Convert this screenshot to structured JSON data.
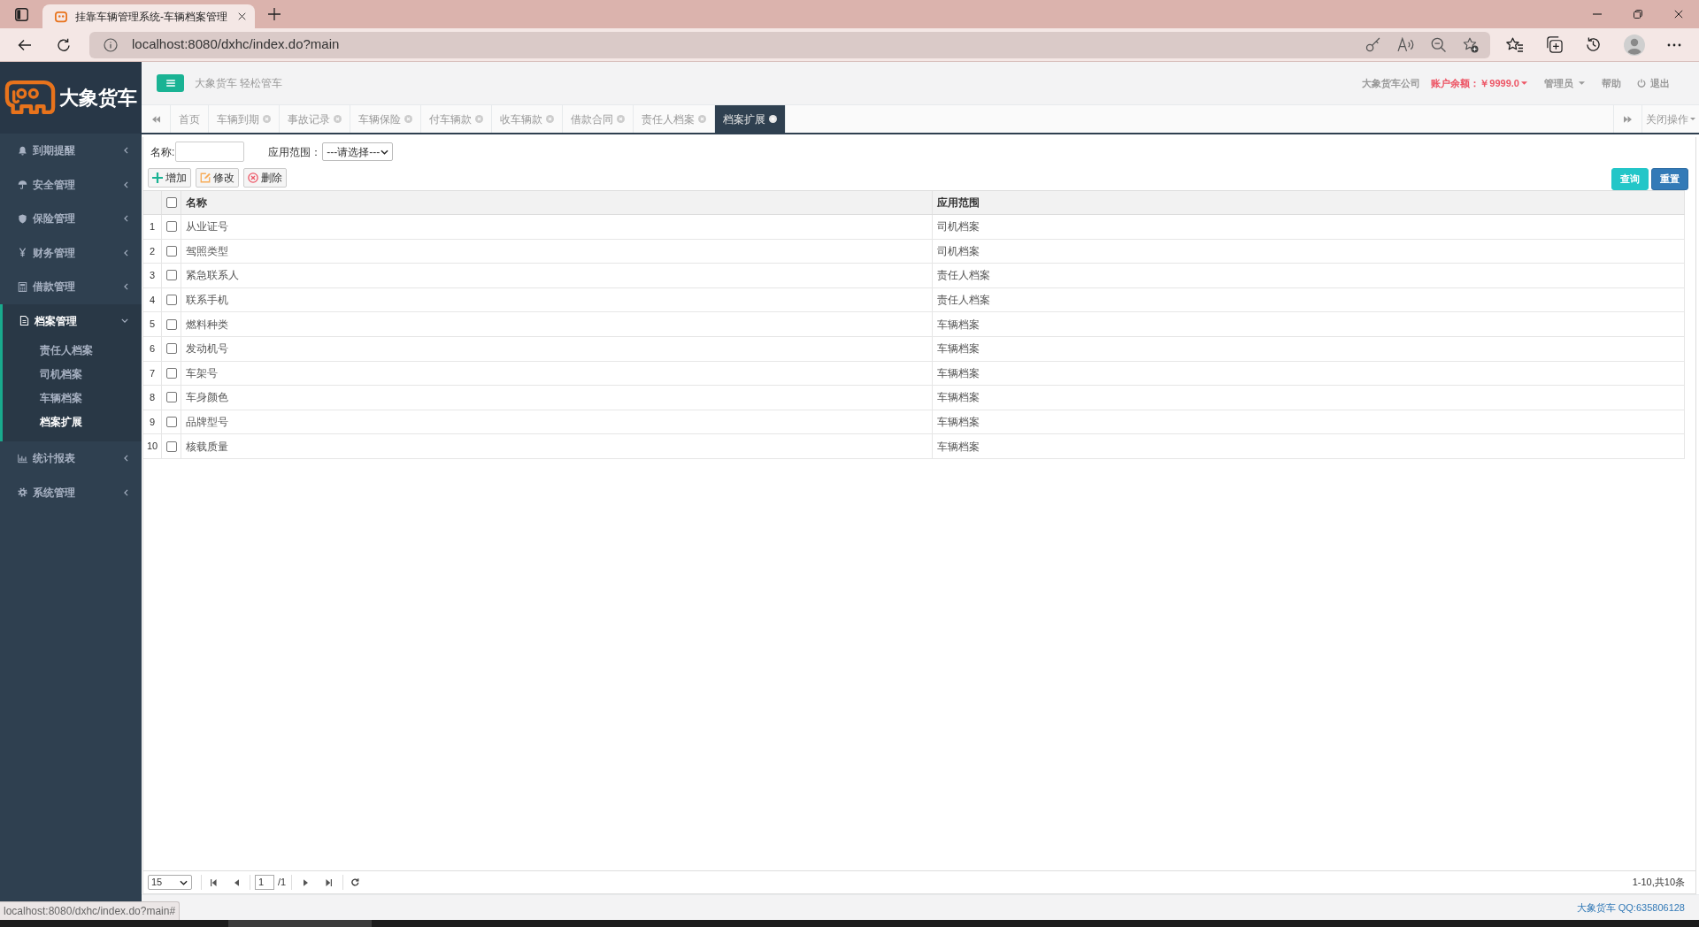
{
  "browser": {
    "tab_title": "挂靠车辆管理系统-车辆档案管理",
    "url": "localhost:8080/dxhc/index.do?main",
    "status_url": "localhost:8080/dxhc/index.do?main#"
  },
  "sidebar": {
    "logo_text": "大象货车",
    "items": [
      {
        "label": "到期提醒",
        "expanded": false
      },
      {
        "label": "安全管理",
        "expanded": false
      },
      {
        "label": "保险管理",
        "expanded": false
      },
      {
        "label": "财务管理",
        "expanded": false
      },
      {
        "label": "借款管理",
        "expanded": false
      },
      {
        "label": "档案管理",
        "expanded": true,
        "children": [
          {
            "label": "责任人档案",
            "selected": false
          },
          {
            "label": "司机档案",
            "selected": false
          },
          {
            "label": "车辆档案",
            "selected": false
          },
          {
            "label": "档案扩展",
            "selected": true
          }
        ]
      },
      {
        "label": "统计报表",
        "expanded": false
      },
      {
        "label": "系统管理",
        "expanded": false
      }
    ]
  },
  "header": {
    "slogan": "大象货车 轻松管车",
    "company": "大象货车公司",
    "balance": "账户余额：￥9999.0",
    "user": "管理员",
    "help": "帮助",
    "logout": "退出"
  },
  "tabs": [
    {
      "label": "首页",
      "closable": false,
      "selected": false
    },
    {
      "label": "车辆到期",
      "closable": true,
      "selected": false
    },
    {
      "label": "事故记录",
      "closable": true,
      "selected": false
    },
    {
      "label": "车辆保险",
      "closable": true,
      "selected": false
    },
    {
      "label": "付车辆款",
      "closable": true,
      "selected": false
    },
    {
      "label": "收车辆款",
      "closable": true,
      "selected": false
    },
    {
      "label": "借款合同",
      "closable": true,
      "selected": false
    },
    {
      "label": "责任人档案",
      "closable": true,
      "selected": false
    },
    {
      "label": "档案扩展",
      "closable": true,
      "selected": true
    }
  ],
  "tab_menu": "关闭操作",
  "filters": {
    "name_label": "名称:",
    "scope_label": "应用范围：",
    "scope_select": "---请选择---"
  },
  "toolbar": [
    "增加",
    "修改",
    "删除"
  ],
  "search_buttons": [
    "查询",
    "重置"
  ],
  "table": {
    "columns": [
      "名称",
      "应用范围"
    ],
    "select_all": false,
    "rows": [
      {
        "number": "1",
        "checked": false,
        "name": "从业证号",
        "scope": "司机档案"
      },
      {
        "number": "2",
        "checked": false,
        "name": "驾照类型",
        "scope": "司机档案"
      },
      {
        "number": "3",
        "checked": false,
        "name": "紧急联系人",
        "scope": "责任人档案"
      },
      {
        "number": "4",
        "checked": false,
        "name": "联系手机",
        "scope": "责任人档案"
      },
      {
        "number": "5",
        "checked": false,
        "name": "燃料种类",
        "scope": "车辆档案"
      },
      {
        "number": "6",
        "checked": false,
        "name": "发动机号",
        "scope": "车辆档案"
      },
      {
        "number": "7",
        "checked": false,
        "name": "车架号",
        "scope": "车辆档案"
      },
      {
        "number": "8",
        "checked": false,
        "name": "车身颜色",
        "scope": "车辆档案"
      },
      {
        "number": "9",
        "checked": false,
        "name": "品牌型号",
        "scope": "车辆档案"
      },
      {
        "number": "10",
        "checked": false,
        "name": "核载质量",
        "scope": "车辆档案"
      }
    ]
  },
  "pager": {
    "page_size": "15",
    "page": "1",
    "page_total": "/1",
    "summary": "1-10,共10条"
  },
  "footer": "大象货车 QQ:635806128"
}
